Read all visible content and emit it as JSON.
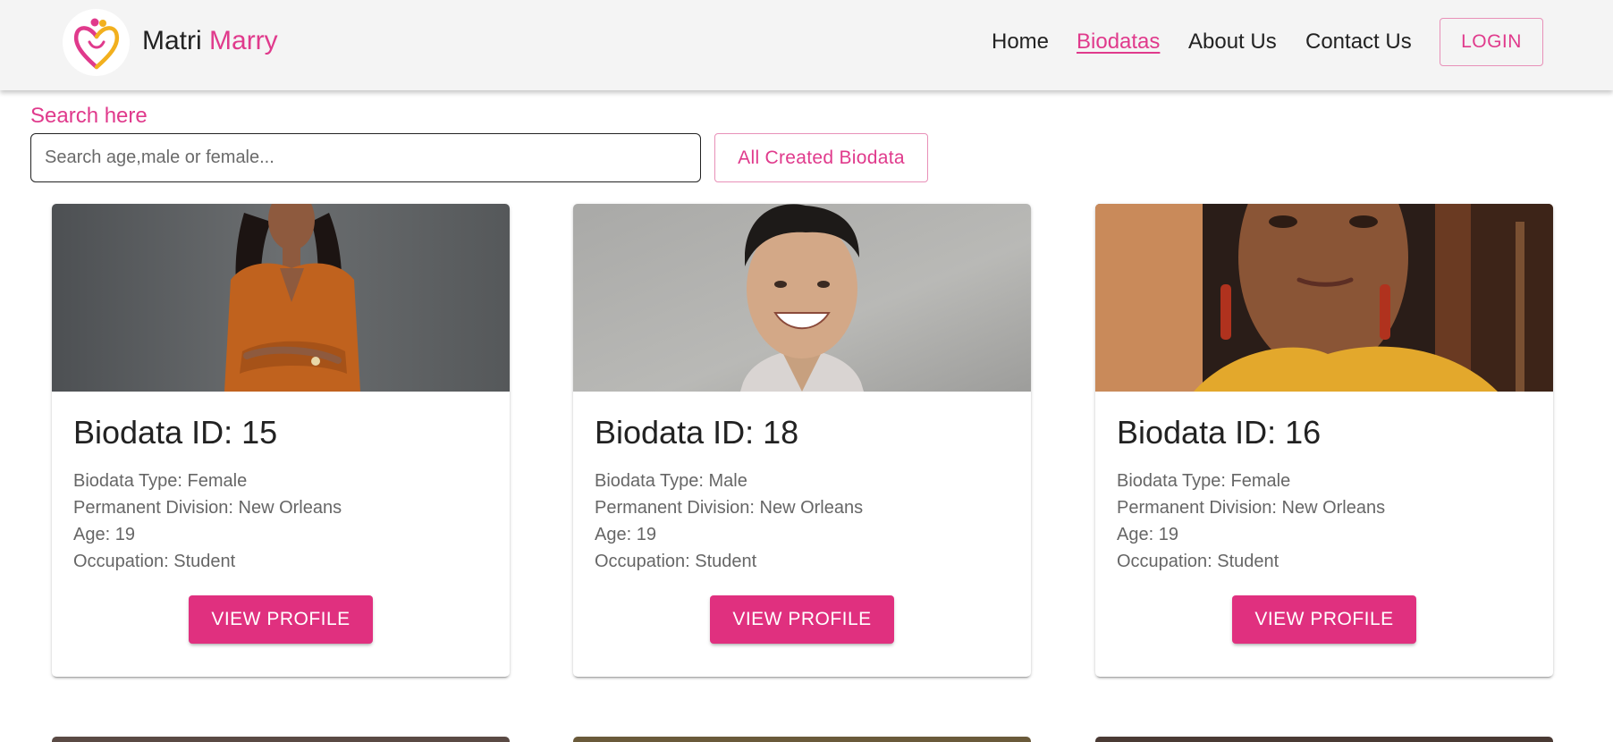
{
  "header": {
    "brand_first": "Matri",
    "brand_second": "Marry",
    "nav": [
      "Home",
      "Biodatas",
      "About Us",
      "Contact Us"
    ],
    "active_nav": "Biodatas",
    "login_label": "LOGIN",
    "accent_color": "#e03a8c"
  },
  "search": {
    "label": "Search here",
    "placeholder": "Search age,male or female...",
    "value": "",
    "all_button_label": "All Created Biodata"
  },
  "cards": [
    {
      "title": "Biodata ID: 15",
      "type": "Biodata Type: Female",
      "division": "Permanent Division: New Orleans",
      "age": "Age: 19",
      "occupation": "Occupation: Student",
      "button": "VIEW PROFILE"
    },
    {
      "title": "Biodata ID: 18",
      "type": "Biodata Type: Male",
      "division": "Permanent Division: New Orleans",
      "age": "Age: 19",
      "occupation": "Occupation: Student",
      "button": "VIEW PROFILE"
    },
    {
      "title": "Biodata ID: 16",
      "type": "Biodata Type: Female",
      "division": "Permanent Division: New Orleans",
      "age": "Age: 19",
      "occupation": "Occupation: Student",
      "button": "VIEW PROFILE"
    }
  ]
}
